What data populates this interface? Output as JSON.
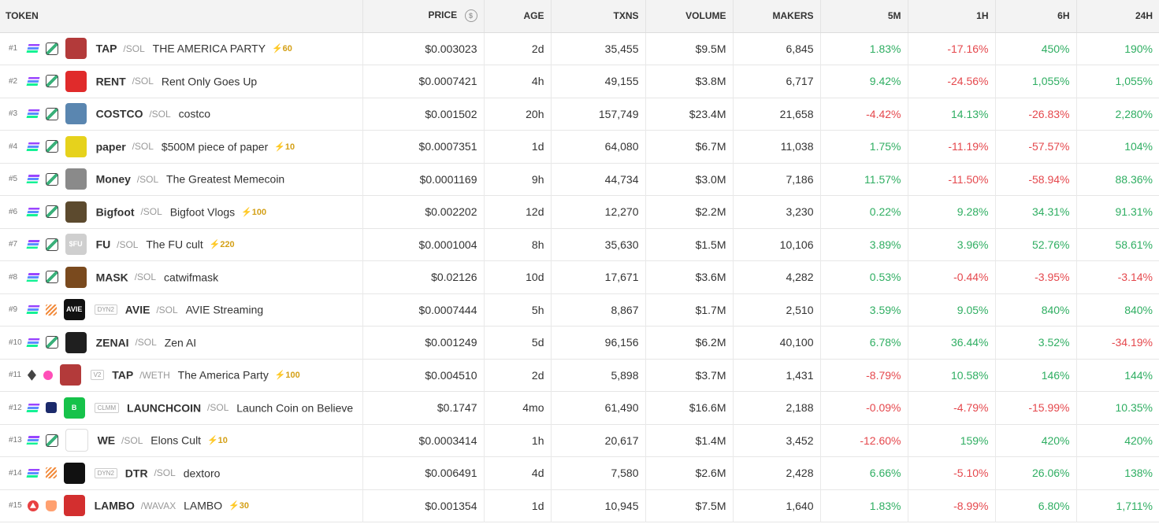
{
  "columns": {
    "token": "TOKEN",
    "price": "PRICE",
    "age": "AGE",
    "txns": "TXNS",
    "volume": "VOLUME",
    "makers": "MAKERS",
    "m5": "5M",
    "h1": "1H",
    "h6": "6H",
    "h24": "24H"
  },
  "icons": {
    "price_header": "dollar-circle-icon"
  },
  "colors": {
    "positive": "#2fae62",
    "negative": "#e5484d",
    "boost": "#d4a017"
  },
  "rows": [
    {
      "rank": "#1",
      "chain": "solana",
      "dex": "raydium",
      "avatar_color": "#b33a3a",
      "avatar_text": "",
      "badge": "",
      "symbol": "TAP",
      "quote": "/SOL",
      "name": "THE AMERICA PARTY",
      "boost": "⚡60",
      "price": "$0.003023",
      "age": "2d",
      "txns": "35,455",
      "volume": "$9.5M",
      "makers": "6,845",
      "m5": "1.83%",
      "h1": "-17.16%",
      "h6": "450%",
      "h24": "190%"
    },
    {
      "rank": "#2",
      "chain": "solana",
      "dex": "raydium",
      "avatar_color": "#e02b2b",
      "avatar_text": "",
      "badge": "",
      "symbol": "RENT",
      "quote": "/SOL",
      "name": "Rent Only Goes Up",
      "boost": "",
      "price": "$0.0007421",
      "age": "4h",
      "txns": "49,155",
      "volume": "$3.8M",
      "makers": "6,717",
      "m5": "9.42%",
      "h1": "-24.56%",
      "h6": "1,055%",
      "h24": "1,055%"
    },
    {
      "rank": "#3",
      "chain": "solana",
      "dex": "raydium",
      "avatar_color": "#5a86b0",
      "avatar_text": "",
      "badge": "",
      "symbol": "COSTCO",
      "quote": "/SOL",
      "name": "costco",
      "boost": "",
      "price": "$0.001502",
      "age": "20h",
      "txns": "157,749",
      "volume": "$23.4M",
      "makers": "21,658",
      "m5": "-4.42%",
      "h1": "14.13%",
      "h6": "-26.83%",
      "h24": "2,280%"
    },
    {
      "rank": "#4",
      "chain": "solana",
      "dex": "raydium",
      "avatar_color": "#e6d21c",
      "avatar_text": "",
      "badge": "",
      "symbol": "paper",
      "quote": "/SOL",
      "name": "$500M piece of paper",
      "boost": "⚡10",
      "price": "$0.0007351",
      "age": "1d",
      "txns": "64,080",
      "volume": "$6.7M",
      "makers": "11,038",
      "m5": "1.75%",
      "h1": "-11.19%",
      "h6": "-57.57%",
      "h24": "104%"
    },
    {
      "rank": "#5",
      "chain": "solana",
      "dex": "raydium",
      "avatar_color": "#8a8a8a",
      "avatar_text": "",
      "badge": "",
      "symbol": "Money",
      "quote": "/SOL",
      "name": "The Greatest Memecoin",
      "boost": "",
      "price": "$0.0001169",
      "age": "9h",
      "txns": "44,734",
      "volume": "$3.0M",
      "makers": "7,186",
      "m5": "11.57%",
      "h1": "-11.50%",
      "h6": "-58.94%",
      "h24": "88.36%"
    },
    {
      "rank": "#6",
      "chain": "solana",
      "dex": "raydium",
      "avatar_color": "#5c4a2e",
      "avatar_text": "",
      "badge": "",
      "symbol": "Bigfoot",
      "quote": "/SOL",
      "name": "Bigfoot Vlogs",
      "boost": "⚡100",
      "price": "$0.002202",
      "age": "12d",
      "txns": "12,270",
      "volume": "$2.2M",
      "makers": "3,230",
      "m5": "0.22%",
      "h1": "9.28%",
      "h6": "34.31%",
      "h24": "91.31%"
    },
    {
      "rank": "#7",
      "chain": "solana",
      "dex": "raydium",
      "avatar_color": "#cfcfcf",
      "avatar_text": "$FU",
      "badge": "",
      "symbol": "FU",
      "quote": "/SOL",
      "name": "The FU cult",
      "boost": "⚡220",
      "price": "$0.0001004",
      "age": "8h",
      "txns": "35,630",
      "volume": "$1.5M",
      "makers": "10,106",
      "m5": "3.89%",
      "h1": "3.96%",
      "h6": "52.76%",
      "h24": "58.61%"
    },
    {
      "rank": "#8",
      "chain": "solana",
      "dex": "raydium",
      "avatar_color": "#7a4a1e",
      "avatar_text": "",
      "badge": "",
      "symbol": "MASK",
      "quote": "/SOL",
      "name": "catwifmask",
      "boost": "",
      "price": "$0.02126",
      "age": "10d",
      "txns": "17,671",
      "volume": "$3.6M",
      "makers": "4,282",
      "m5": "0.53%",
      "h1": "-0.44%",
      "h6": "-3.95%",
      "h24": "-3.14%"
    },
    {
      "rank": "#9",
      "chain": "solana",
      "dex": "meteora",
      "avatar_color": "#111111",
      "avatar_text": "AVIE",
      "badge": "DYN2",
      "symbol": "AVIE",
      "quote": "/SOL",
      "name": "AVIE Streaming",
      "boost": "",
      "price": "$0.0007444",
      "age": "5h",
      "txns": "8,867",
      "volume": "$1.7M",
      "makers": "2,510",
      "m5": "3.59%",
      "h1": "9.05%",
      "h6": "840%",
      "h24": "840%"
    },
    {
      "rank": "#10",
      "chain": "solana",
      "dex": "raydium",
      "avatar_color": "#1f1f1f",
      "avatar_text": "",
      "badge": "",
      "symbol": "ZENAI",
      "quote": "/SOL",
      "name": "Zen AI",
      "boost": "",
      "price": "$0.001249",
      "age": "5d",
      "txns": "96,156",
      "volume": "$6.2M",
      "makers": "40,100",
      "m5": "6.78%",
      "h1": "36.44%",
      "h6": "3.52%",
      "h24": "-34.19%"
    },
    {
      "rank": "#11",
      "chain": "eth",
      "dex": "unicorn",
      "avatar_color": "#b33a3a",
      "avatar_text": "",
      "badge": "V2",
      "symbol": "TAP",
      "quote": "/WETH",
      "name": "The America Party",
      "boost": "⚡100",
      "price": "$0.004510",
      "age": "2d",
      "txns": "5,898",
      "volume": "$3.7M",
      "makers": "1,431",
      "m5": "-8.79%",
      "h1": "10.58%",
      "h6": "146%",
      "h24": "144%"
    },
    {
      "rank": "#12",
      "chain": "solana",
      "dex": "believe",
      "avatar_color": "#16c24a",
      "avatar_text": "B",
      "badge": "CLMM",
      "symbol": "LAUNCHCOIN",
      "quote": "/SOL",
      "name": "Launch Coin on Believe",
      "boost": "",
      "price": "$0.1747",
      "age": "4mo",
      "txns": "61,490",
      "volume": "$16.6M",
      "makers": "2,188",
      "m5": "-0.09%",
      "h1": "-4.79%",
      "h6": "-15.99%",
      "h24": "10.35%"
    },
    {
      "rank": "#13",
      "chain": "solana",
      "dex": "raydium",
      "avatar_color": "#ffffff",
      "avatar_text": "",
      "badge": "",
      "symbol": "WE",
      "quote": "/SOL",
      "name": "Elons Cult",
      "boost": "⚡10",
      "price": "$0.0003414",
      "age": "1h",
      "txns": "20,617",
      "volume": "$1.4M",
      "makers": "3,452",
      "m5": "-12.60%",
      "h1": "159%",
      "h6": "420%",
      "h24": "420%"
    },
    {
      "rank": "#14",
      "chain": "solana",
      "dex": "meteora",
      "avatar_color": "#111111",
      "avatar_text": "",
      "badge": "DYN2",
      "symbol": "DTR",
      "quote": "/SOL",
      "name": "dextoro",
      "boost": "",
      "price": "$0.006491",
      "age": "4d",
      "txns": "7,580",
      "volume": "$2.6M",
      "makers": "2,428",
      "m5": "6.66%",
      "h1": "-5.10%",
      "h6": "26.06%",
      "h24": "138%"
    },
    {
      "rank": "#15",
      "chain": "avax",
      "dex": "pharaoh",
      "avatar_color": "#d32f2f",
      "avatar_text": "",
      "badge": "",
      "symbol": "LAMBO",
      "quote": "/WAVAX",
      "name": "LAMBO",
      "boost": "⚡30",
      "price": "$0.001354",
      "age": "1d",
      "txns": "10,945",
      "volume": "$7.5M",
      "makers": "1,640",
      "m5": "1.83%",
      "h1": "-8.99%",
      "h6": "6.80%",
      "h24": "1,711%"
    }
  ]
}
